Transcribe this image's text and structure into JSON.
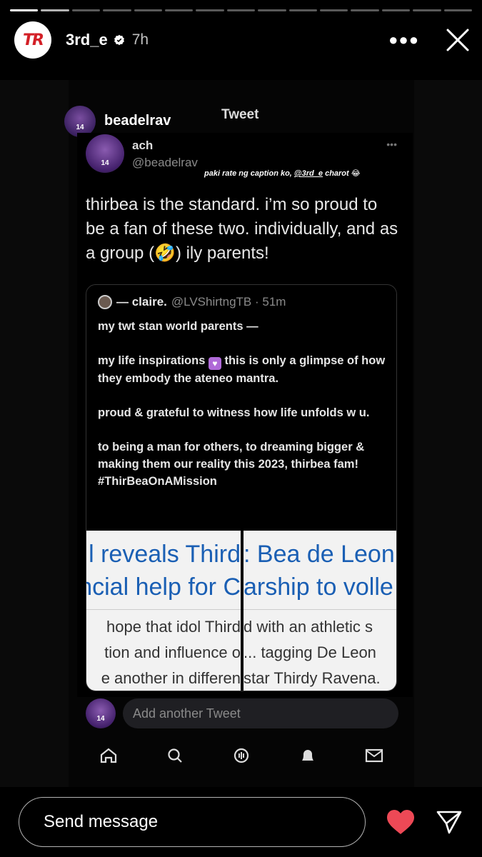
{
  "story": {
    "segments_total": 15,
    "segments_viewed": 1,
    "username": "3rd_e",
    "verified": true,
    "time_ago": "7h",
    "logo_text": "TR",
    "brand_color": "#d32027"
  },
  "screenshot": {
    "top_username": "beadelrav",
    "screen_title": "Tweet",
    "tweet": {
      "display_name": "ach",
      "handle": "@beadelrav",
      "jersey_number": "14",
      "caption_overlay": "paki rate ng caption ko, ",
      "caption_mention": "@3rd_e",
      "caption_tail": " charot 😂",
      "text": "thirbea is the standard. i’m so proud to be a fan of these two. individually, and as a group (🤣) ily parents!",
      "quote": {
        "name": "— claire.",
        "meta": "@LVShirtngTB · 51m",
        "line1": "my twt stan world parents —",
        "line2_a": "my life inspirations ",
        "line2_b": " this is only a glimpse of how they embody the ateneo mantra.",
        "line3": "proud & grateful to witness how life unfolds w u.",
        "line4": "to being a man for others, to dreaming bigger & making them our reality this 2023, thirbea fam!",
        "hashtag": "#ThirBeaOnAMission",
        "image_left": {
          "h1": "l reveals Third",
          "h2": "ncial help for C",
          "l1": "hope that idol Third",
          "l2": "tion and influence o",
          "l3": "e another in differen"
        },
        "image_right": {
          "h1": ": Bea de Leon",
          "h2": "arship to volle",
          "l1": "d with an athletic s",
          "l2": "... tagging De Leon",
          "l3": "star Thirdy Ravena."
        }
      }
    },
    "reply_placeholder": "Add another Tweet",
    "tabs": [
      "home-icon",
      "search-icon",
      "spaces-icon",
      "notifications-icon",
      "messages-icon"
    ]
  },
  "bottom": {
    "send_placeholder": "Send message",
    "like_color": "#ed4956"
  }
}
